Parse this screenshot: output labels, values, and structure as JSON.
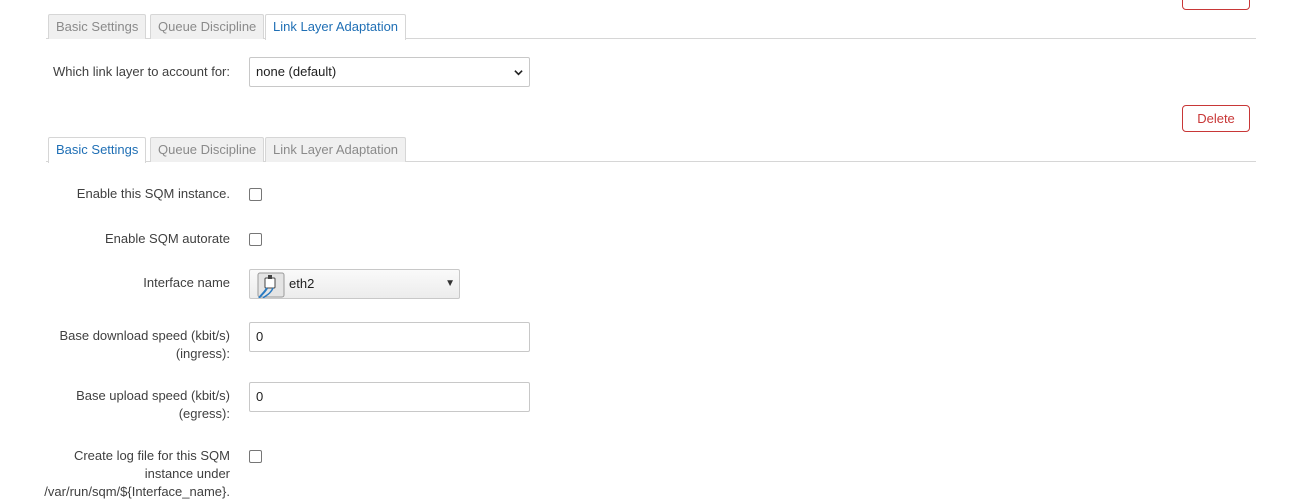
{
  "top_section": {
    "tabs": [
      {
        "label": "Basic Settings",
        "active": false
      },
      {
        "label": "Queue Discipline",
        "active": false
      },
      {
        "label": "Link Layer Adaptation",
        "active": true
      }
    ],
    "link_layer": {
      "label": "Which link layer to account for:",
      "value": "none (default)"
    }
  },
  "second_section": {
    "delete_label": "Delete",
    "tabs": [
      {
        "label": "Basic Settings",
        "active": true
      },
      {
        "label": "Queue Discipline",
        "active": false
      },
      {
        "label": "Link Layer Adaptation",
        "active": false
      }
    ],
    "fields": {
      "enable_instance": {
        "label": "Enable this SQM instance.",
        "checked": false
      },
      "enable_autorate": {
        "label": "Enable SQM autorate",
        "checked": false
      },
      "interface": {
        "label": "Interface name",
        "value": "eth2",
        "icon": "ethernet-port-icon"
      },
      "download": {
        "label_line1": "Base download speed (kbit/s)",
        "label_line2": "(ingress):",
        "value": "0"
      },
      "upload": {
        "label_line1": "Base upload speed (kbit/s)",
        "label_line2": "(egress):",
        "value": "0"
      },
      "log_file": {
        "label_line1": "Create log file for this SQM",
        "label_line2": "instance under",
        "label_line3": "/var/run/sqm/${Interface_name}.",
        "checked": false
      }
    }
  },
  "colors": {
    "accent": "#1f6fb5",
    "danger": "#c83737",
    "border": "#d6d6d6"
  }
}
